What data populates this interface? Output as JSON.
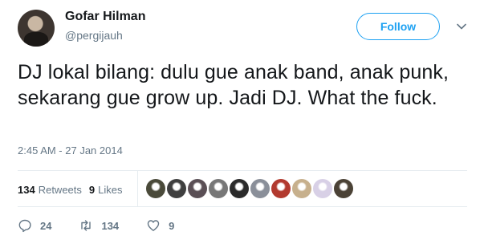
{
  "author": {
    "name": "Gofar Hilman",
    "handle": "@pergijauh"
  },
  "follow_button": {
    "label": "Follow"
  },
  "menu": {
    "icon": "chevron-down-icon"
  },
  "tweet": {
    "text": "DJ lokal bilang: dulu gue anak band, anak punk, sekarang gue grow up. Jadi DJ. What the fuck.",
    "timestamp": "2:45 AM - 27 Jan 2014"
  },
  "stats": {
    "retweets_count": "134",
    "retweets_label": "Retweets",
    "likes_count": "9",
    "likes_label": "Likes"
  },
  "likers_count": 10,
  "actions": {
    "reply": {
      "icon": "reply-icon",
      "count": "24"
    },
    "retweet": {
      "icon": "retweet-icon",
      "count": "134"
    },
    "like": {
      "icon": "heart-icon",
      "count": "9"
    }
  },
  "colors": {
    "accent": "#1da1f2",
    "secondary_text": "#657786",
    "text": "#14171a",
    "divider": "#e6ecf0"
  }
}
